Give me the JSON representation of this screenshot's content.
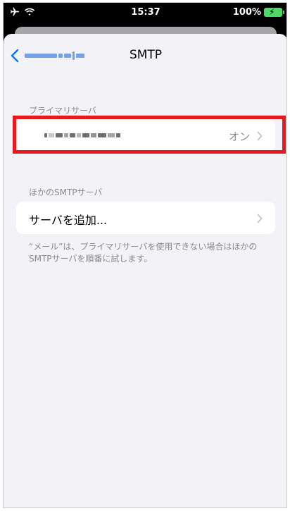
{
  "status_bar": {
    "time": "15:37",
    "battery_percent": "100%",
    "icons": [
      "airplane-icon",
      "wifi-icon",
      "battery-charging-icon"
    ]
  },
  "nav": {
    "title": "SMTP",
    "back_label": ""
  },
  "primary_server": {
    "header": "プライマリサーバ",
    "value": "オン"
  },
  "other_servers": {
    "header": "ほかのSMTPサーバ",
    "add_label": "サーバを追加..."
  },
  "footer_note": "“メール”は、プライマリサーバを使用できない場合はほかのSMTPサーバを順番に試します。",
  "colors": {
    "accent": "#007aff",
    "highlight": "#e8191e",
    "background": "#f2f2f7",
    "secondary_text": "#8a8a8e"
  }
}
